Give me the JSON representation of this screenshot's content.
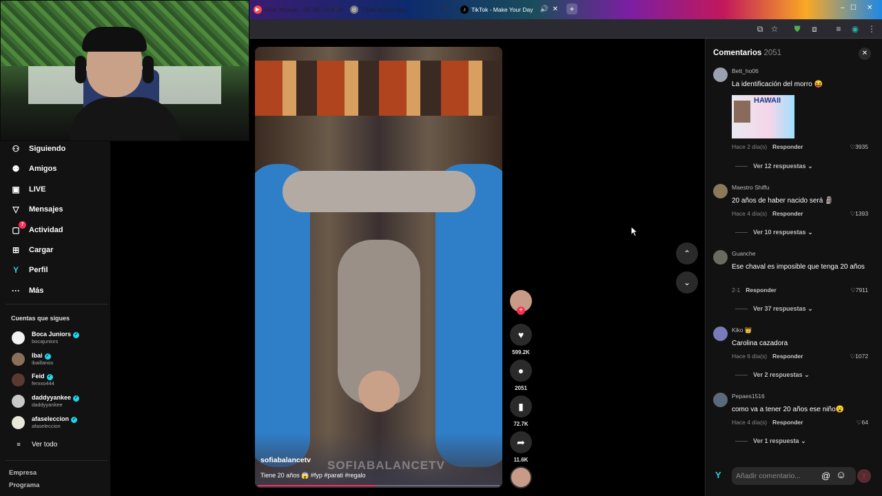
{
  "browser": {
    "tabs": [
      {
        "title": "Feid, Maisak - SE ME OLVIDA",
        "bg": "#c9c0d8"
      },
      {
        "title": "Título directo hoy",
        "bg": "#d9cfe8"
      },
      {
        "title": "TikTok - Make Your Day",
        "bg": "#2b2b32"
      }
    ],
    "new_tab": "+",
    "window_controls": [
      "–",
      "☐",
      "✕"
    ]
  },
  "sidebar": {
    "nav": [
      {
        "label": "Siguiendo",
        "icon": "following-icon",
        "glyph": "⚇"
      },
      {
        "label": "Amigos",
        "icon": "friends-icon",
        "glyph": "⚉"
      },
      {
        "label": "LIVE",
        "icon": "live-icon",
        "glyph": "▣"
      },
      {
        "label": "Mensajes",
        "icon": "messages-icon",
        "glyph": "▽"
      },
      {
        "label": "Actividad",
        "icon": "activity-icon",
        "glyph": "▢",
        "badge": "7"
      },
      {
        "label": "Cargar",
        "icon": "upload-icon",
        "glyph": "⊞"
      },
      {
        "label": "Perfil",
        "icon": "profile-icon",
        "glyph": "Y"
      },
      {
        "label": "Más",
        "icon": "more-icon",
        "glyph": "···"
      }
    ],
    "following_title": "Cuentas que sigues",
    "following": [
      {
        "name": "Boca Juniors",
        "handle": "bocajuniors",
        "color": "#f2f2f2"
      },
      {
        "name": "Ibai",
        "handle": "ibaillanos",
        "color": "#8a6f5a"
      },
      {
        "name": "Feid",
        "handle": "ferxxo444",
        "color": "#5a3a30"
      },
      {
        "name": "daddyyankee",
        "handle": "daddyyankee",
        "color": "#c8c8c8"
      },
      {
        "name": "afaseleccion",
        "handle": "afaseleccion",
        "color": "#e8e8d8"
      }
    ],
    "see_all": "Ver todo",
    "footer": [
      "Empresa",
      "Programa"
    ]
  },
  "video": {
    "author": "sofiabalancetv",
    "caption": "Tiene 20 años 😱 #fyp #parati #regalo",
    "watermark": "SOFIABALANCETV",
    "progress": 0.49
  },
  "actions": {
    "likes": "599.2K",
    "comments": "2051",
    "saves": "72.7K",
    "shares": "11.6K",
    "follow_plus": "+"
  },
  "comments": {
    "title": "Comentarios",
    "count": "2051",
    "close": "✕",
    "items": [
      {
        "user": "Bett_ho06",
        "text": "La identificación del morro 😝",
        "time": "Hace 2 día(s)",
        "reply": "Responder",
        "likes": "3935",
        "replies": "Ver 12 respuestas",
        "avatar": "#9aa0b0",
        "sticker_text": "HAWAII"
      },
      {
        "user": "Maestro Shiffu",
        "text": "20 años de haber nacido será 🗿",
        "time": "Hace 4 día(s)",
        "reply": "Responder",
        "likes": "1393",
        "replies": "Ver 10 respuestas",
        "avatar": "#8a7a5a"
      },
      {
        "user": "Guanche",
        "text": "Ese chaval es imposible que tenga 20 años",
        "time": "2-1",
        "reply": "Responder",
        "likes": "7911",
        "replies": "Ver 37 respuestas",
        "avatar": "#6a6a60"
      },
      {
        "user": "Kiko 👑",
        "text": "Carolina cazadora",
        "time": "Hace 6 día(s)",
        "reply": "Responder",
        "likes": "1072",
        "replies": "Ver 2 respuestas",
        "avatar": "#7a7ab8"
      },
      {
        "user": "Pepaes1516",
        "text": "como va a tener 20 años ese niño😮",
        "time": "Hace 4 día(s)",
        "reply": "Responder",
        "likes": "64",
        "replies": "Ver 1 respuesta",
        "avatar": "#5a6a7a"
      }
    ],
    "input_placeholder": "Añadir comentario...",
    "mention": "@",
    "emoji": "☺",
    "send": "↑"
  }
}
